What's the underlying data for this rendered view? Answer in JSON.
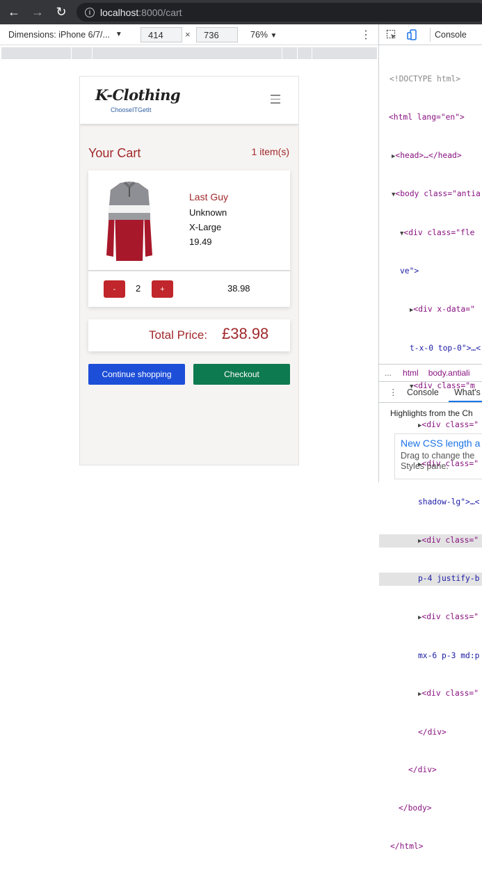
{
  "browser": {
    "url_host": "localhost",
    "url_rest": ":8000/cart"
  },
  "device_toolbar": {
    "device_label": "Dimensions: iPhone 6/7/...",
    "width": "414",
    "height": "736",
    "times": "×",
    "zoom": "76%"
  },
  "site": {
    "logo": "K-Clothing",
    "tagline": "ChooseITGetIt"
  },
  "cart": {
    "title": "Your Cart",
    "count": "1 item(s)",
    "item": {
      "name": "Last Guy",
      "brand": "Unknown",
      "size": "X-Large",
      "price": "19.49",
      "qty": "2",
      "minus": "-",
      "plus": "+",
      "line_total": "38.98"
    },
    "total_label": "Total Price:",
    "total_value": "£38.98",
    "continue_label": "Continue shopping",
    "checkout_label": "Checkout"
  },
  "devtools": {
    "tab_console": "Console",
    "crumbs": [
      "...",
      "html",
      "body.antiali"
    ],
    "drawer_tabs": [
      "Console",
      "What's"
    ],
    "highlights": "Highlights from the Ch",
    "card_title": "New CSS length a",
    "card_body": "Drag to change the Styles pane.",
    "dom_lines": [
      "<!DOCTYPE html>",
      "<html lang=\"en\">",
      "<head>…</head>",
      "<body class=\"antia",
      "<div class=\"fle",
      "ve\">",
      "<div x-data=\"",
      "t-x-0 top-0\">…<",
      "<div class=\"m",
      "<div class=\"",
      "<div class=\"",
      "shadow-lg\">…<",
      "<div class=\"",
      "p-4 justify-b",
      "<div class=\"",
      "mx-6 p-3 md:p",
      "<div class=\"",
      "</div>",
      "</div>",
      "</body>",
      "</html>"
    ]
  },
  "colors": {
    "brand_red": "#a0282b",
    "continue_blue": "#1d4ed8",
    "checkout_green": "#0e7a4f"
  }
}
